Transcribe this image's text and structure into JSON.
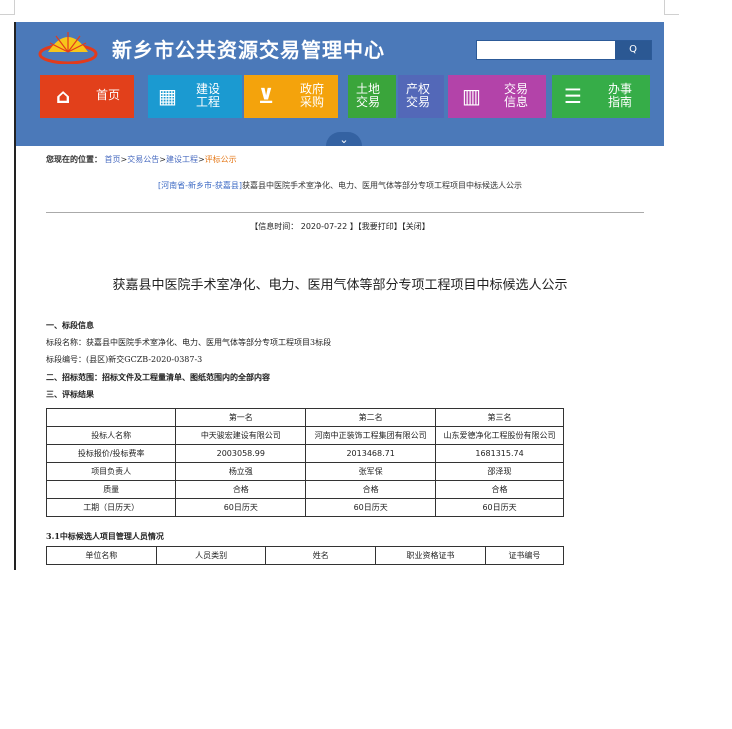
{
  "header": {
    "site_title": "新乡市公共资源交易管理中心",
    "search_placeholder": "",
    "search_button": "Q"
  },
  "nav": [
    {
      "label": "首页",
      "icon": "home-icon",
      "color": "#e2401b"
    },
    {
      "label": "建设\n工程",
      "icon": "building-icon",
      "color": "#1b9ad1"
    },
    {
      "label": "政府\n采购",
      "icon": "cart-icon",
      "color": "#f4a30c"
    },
    {
      "label": "土地\n交易",
      "icon": "land-icon",
      "color": "#3aa53b"
    },
    {
      "label": "产权\n交易",
      "icon": "property-icon",
      "color": "#5368b8"
    },
    {
      "label": "交易\n信息",
      "icon": "bar-chart-icon",
      "color": "#b343a9"
    },
    {
      "label": "办事\n指南",
      "icon": "guide-icon",
      "color": "#36ad48"
    }
  ],
  "breadcrumb": {
    "prefix": "您现在的位置：",
    "home": "首页",
    "sep": ">",
    "l1": "交易公告",
    "l2": "建设工程",
    "current": "评标公示"
  },
  "subtitle": {
    "area": "[河南省-新乡市-获嘉县]",
    "text": "获嘉县中医院手术室净化、电力、医用气体等部分专项工程项目中标候选人公示"
  },
  "meta": {
    "text": "【信息时间： 2020-07-22 】【我要打印】【关闭】"
  },
  "doc_title": "获嘉县中医院手术室净化、电力、医用气体等部分专项工程项目中标候选人公示",
  "lines": [
    {
      "text": "一、标段信息",
      "bold": true
    },
    {
      "text": "标段名称：获嘉县中医院手术室净化、电力、医用气体等部分专项工程项目3标段",
      "bold": false
    },
    {
      "text": "标段编号：(县区)新交GCZB-2020-0387-3",
      "bold": false
    },
    {
      "text": "二、招标范围：招标文件及工程量清单、图纸范围内的全部内容",
      "bold": true
    },
    {
      "text": "三、评标结果",
      "bold": true
    }
  ],
  "results_table": {
    "header": [
      "",
      "第一名",
      "第二名",
      "第三名"
    ],
    "rows": [
      [
        "投标人名称",
        "中天骏宏建设有限公司",
        "河南中正装饰工程集团有限公司",
        "山东爱德净化工程股份有限公司"
      ],
      [
        "投标报价/投标费率",
        "2003058.99",
        "2013468.71",
        "1681315.74"
      ],
      [
        "项目负责人",
        "杨立强",
        "张军保",
        "邵泽现"
      ],
      [
        "质量",
        "合格",
        "合格",
        "合格"
      ],
      [
        "工期（日历天）",
        "60日历天",
        "60日历天",
        "60日历天"
      ]
    ]
  },
  "section_31": "3.1中标候选人项目管理人员情况",
  "staff_table": {
    "header": [
      "单位名称",
      "人员类别",
      "姓名",
      "职业资格证书",
      "证书编号"
    ]
  }
}
